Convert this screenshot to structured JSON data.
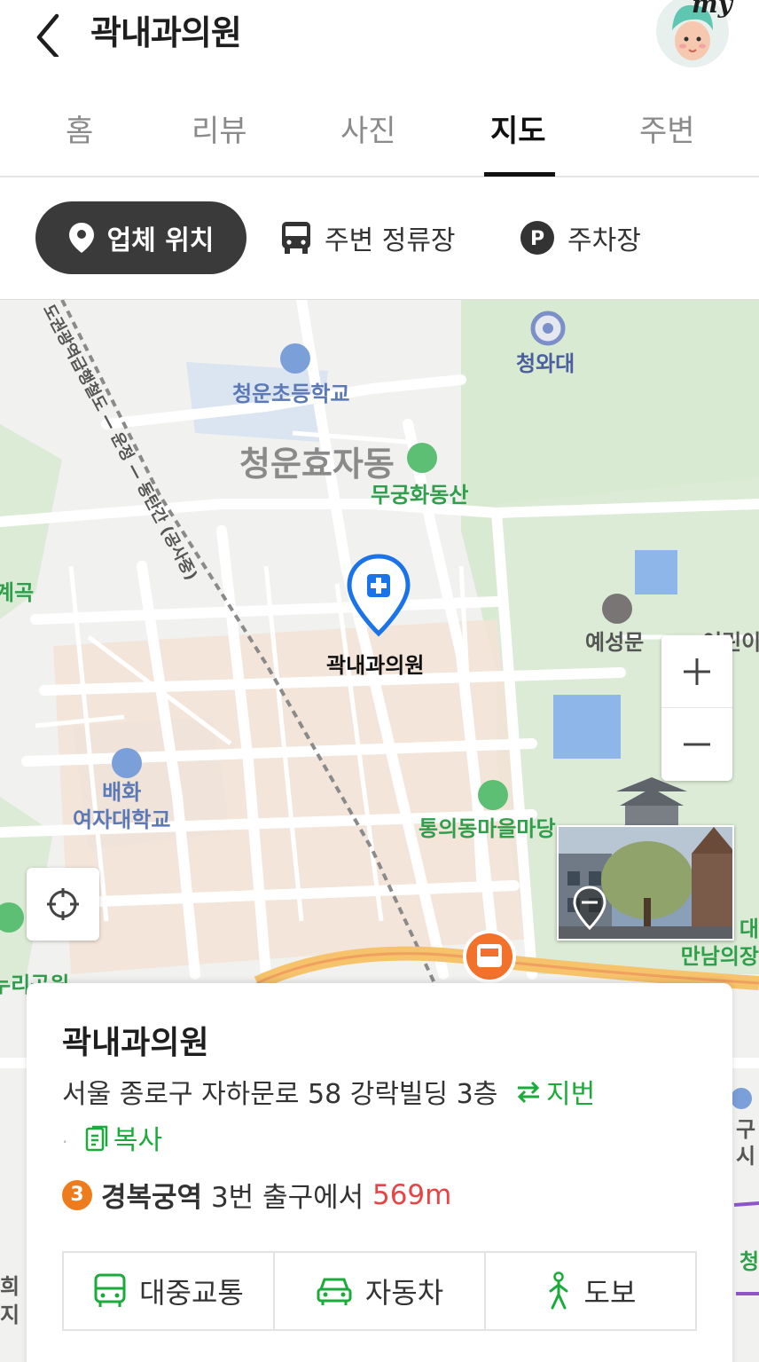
{
  "header": {
    "title": "곽내과의원",
    "avatar_label": "my"
  },
  "tabs": [
    {
      "label": "홈"
    },
    {
      "label": "리뷰"
    },
    {
      "label": "사진"
    },
    {
      "label": "지도",
      "active": true
    },
    {
      "label": "주변"
    }
  ],
  "chips": {
    "location": "업체 위치",
    "bus_stops": "주변 정류장",
    "parking": "주차장"
  },
  "map": {
    "labels": {
      "cheongwadae": "청와대",
      "school": "청운초등학교",
      "district": "청운효자동",
      "park": "무궁화동산",
      "road": "도권광역급행철도 — 운정 — 동탄간 (공사중)",
      "left_edge": "계곡",
      "gate": "예성문",
      "right_edge": "어린이",
      "clinic": "곽내과의원",
      "university": "배화\n여자대학교",
      "madang": "통의동마을마당",
      "right_bottom": "대\n만남의장",
      "left_bottom": "누리공원",
      "right_far": "구\n시",
      "right_far2": "청",
      "left_far": "희\n지"
    }
  },
  "card": {
    "title": "곽내과의원",
    "address": "서울 종로구 자하문로 58 강락빌딩 3층",
    "jibun": "지번",
    "copy": "복사",
    "subway": {
      "line": "3",
      "station": "경복궁역",
      "exit_text": " 3번 출구에서 ",
      "distance": "569m"
    },
    "routes": [
      {
        "label": "대중교통"
      },
      {
        "label": "자동차"
      },
      {
        "label": "도보"
      }
    ]
  },
  "colors": {
    "accent_blue": "#1a73e8",
    "green": "#1aab3a",
    "line3_orange": "#ef7c1c",
    "distance_red": "#e64545"
  }
}
